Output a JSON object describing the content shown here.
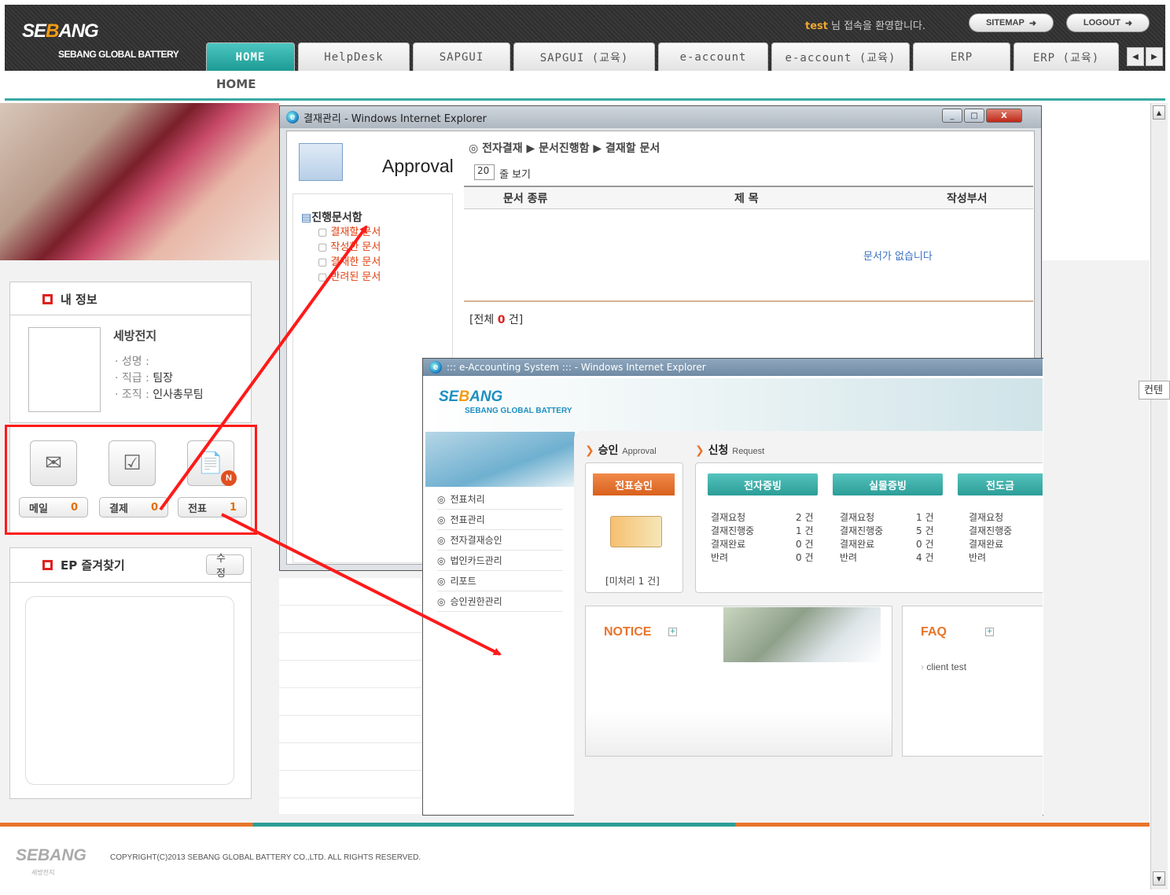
{
  "brand": {
    "logo_prefix": "SE",
    "logo_mid": "B",
    "logo_suffix": "ANG",
    "subtitle": "SEBANG GLOBAL BATTERY"
  },
  "header": {
    "user": "test",
    "welcome": "님 접속을 환영합니다.",
    "sitemap": "SITEMAP",
    "logout": "LOGOUT"
  },
  "tabs": [
    "HOME",
    "HelpDesk",
    "SAPGUI",
    "SAPGUI (교육)",
    "e-account",
    "e-account (교육)",
    "ERP",
    "ERP (교육)"
  ],
  "breadcrumb": "HOME",
  "myinfo": {
    "title": "내 정보",
    "company": "세방전지",
    "name_label": "· 성명 :",
    "grade_label": "· 직급 :",
    "grade": "팀장",
    "org_label": "· 조직 :",
    "org": "인사총무팀"
  },
  "quick": [
    {
      "label": "메일",
      "count": "0"
    },
    {
      "label": "결제",
      "count": "0"
    },
    {
      "label": "전표",
      "count": "1"
    }
  ],
  "favorites": {
    "title": "EP 즐겨찾기",
    "edit": "수정"
  },
  "side_label": "컨텐",
  "footer": {
    "logo": "SEBANG",
    "logo_sub": "세방전지",
    "copyright": "COPYRIGHT(C)2013 SEBANG GLOBAL BATTERY CO.,LTD. ALL RIGHTS RESERVED."
  },
  "approval_window": {
    "title": "결재관리 - Windows Internet Explorer",
    "heading": "Approval",
    "path": "◎ 전자결재 ▶ 문서진행함 ▶ 결재할 문서",
    "page_size": "20",
    "page_size_suffix": "줄 보기",
    "tree_root": "진행문서함",
    "tree_items": [
      "결재할 문서",
      "작성한 문서",
      "결재한 문서",
      "반려된 문서"
    ],
    "columns": [
      "문서 종류",
      "제 목",
      "작성부서"
    ],
    "empty": "문서가 없습니다",
    "total_prefix": "[전체 ",
    "total_count": "0",
    "total_suffix": " 건]"
  },
  "eacc_window": {
    "title": "::: e-Accounting System ::: - Windows Internet Explorer",
    "approval_label": "승인",
    "approval_en": "Approval",
    "request_label": "신청",
    "request_en": "Request",
    "approve_btn": "전표승인",
    "pending": "[미처리 1 건]",
    "menu": [
      "전표처리",
      "전표관리",
      "전자결재승인",
      "법인카드관리",
      "리포트",
      "승인권한관리"
    ],
    "groups": [
      {
        "btn": "전자증빙",
        "rows": [
          [
            "결재요청",
            "2 건"
          ],
          [
            "결재진행중",
            "1 건"
          ],
          [
            "결재완료",
            "0 건"
          ],
          [
            "반려",
            "0 건"
          ]
        ]
      },
      {
        "btn": "실물증빙",
        "rows": [
          [
            "결재요청",
            "1 건"
          ],
          [
            "결재진행중",
            "5 건"
          ],
          [
            "결재완료",
            "0 건"
          ],
          [
            "반려",
            "4 건"
          ]
        ]
      },
      {
        "btn": "전도금",
        "rows": [
          [
            "결재요청",
            ""
          ],
          [
            "결재진행중",
            ""
          ],
          [
            "결재완료",
            ""
          ],
          [
            "반려",
            ""
          ]
        ]
      }
    ],
    "notice": "NOTICE",
    "faq": "FAQ",
    "faq_item": "client test"
  },
  "colors": {
    "teal": "#2b9d97",
    "orange": "#e07000",
    "red_annotation": "#ff1a1a"
  }
}
